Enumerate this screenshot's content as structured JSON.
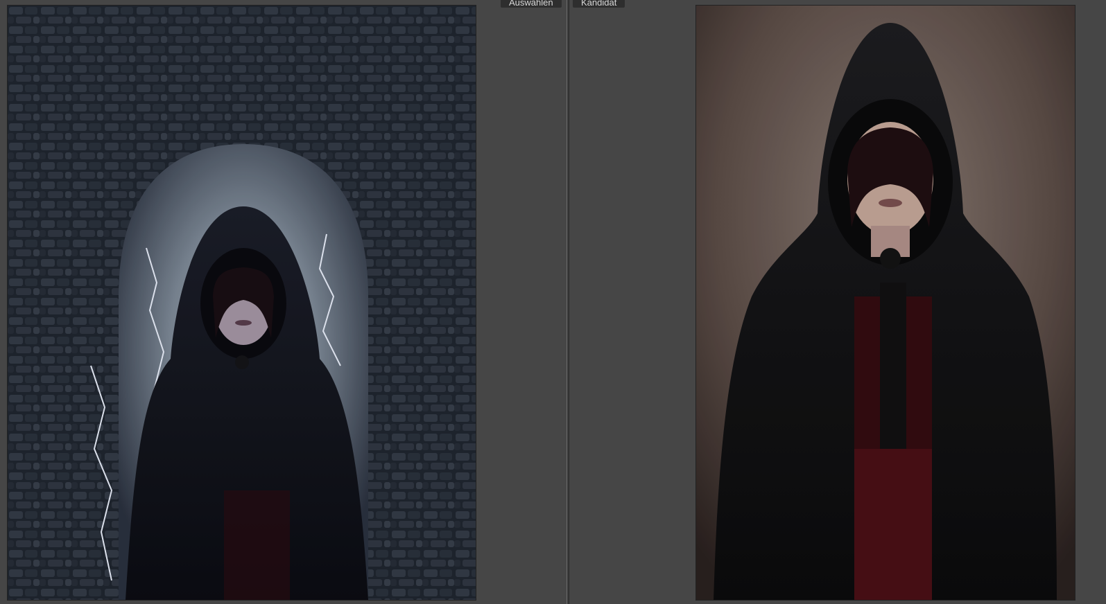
{
  "compare_view": {
    "select_label": "Auswählen",
    "candidate_label": "Kandidat"
  }
}
